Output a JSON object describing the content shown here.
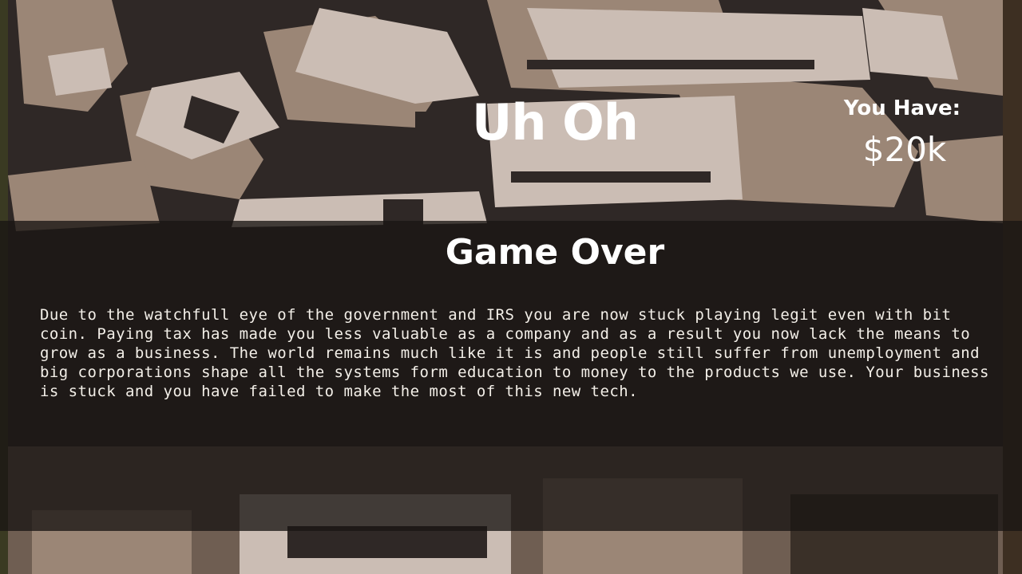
{
  "screen": {
    "title": "Uh Oh",
    "money": {
      "label": "You Have:",
      "value": "$20k"
    }
  },
  "result_panel": {
    "heading": "Game Over",
    "message": "Due to the watchfull eye of the government and IRS you are now stuck playing legit even with bit coin. Paying tax has made you less valuable as a company and as a result you now lack the means to grow as a business. The world remains much like it is and people still suffer from unemployment and big corporations shape all the systems form education to money to the products we use. Your business is stuck and you have failed to make the most of this new tech."
  },
  "colors": {
    "background_dark": "#2f2826",
    "background_tan": "#9b8676",
    "background_light": "#cbbdb4",
    "panel_overlay": "#1a1613",
    "text": "#ffffff"
  }
}
